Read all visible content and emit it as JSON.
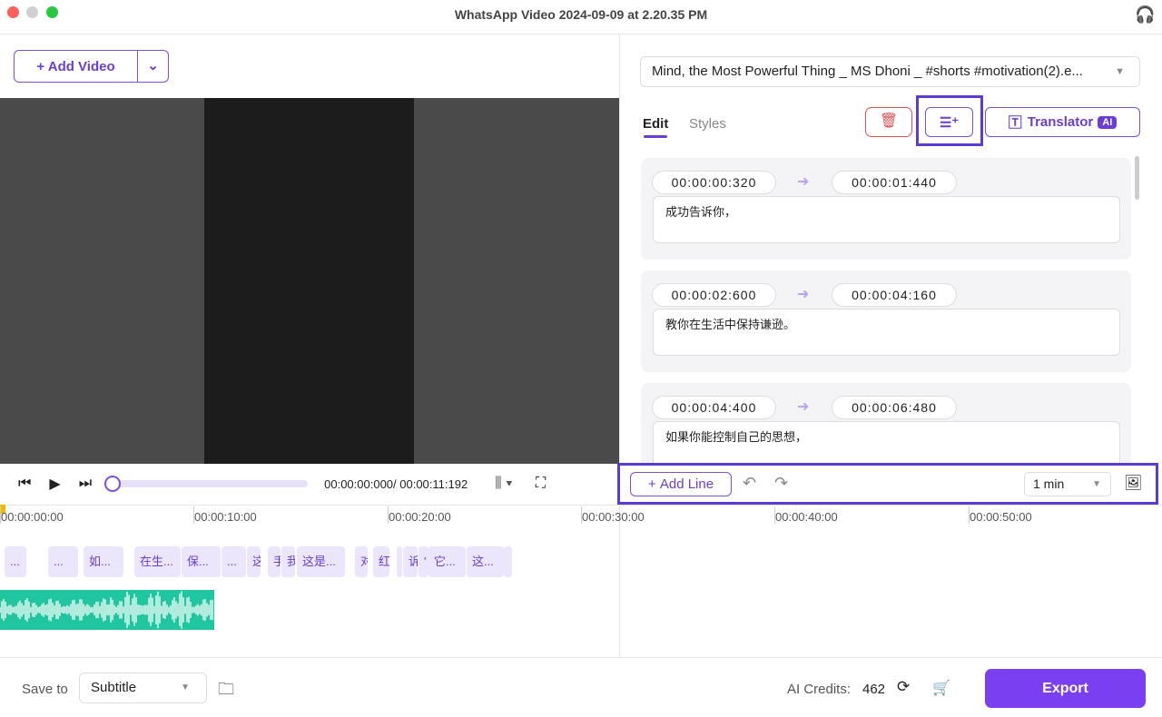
{
  "window": {
    "title": "WhatsApp Video 2024-09-09 at 2.20.35 PM"
  },
  "toolbar": {
    "add_video": "Add Video"
  },
  "player": {
    "time": "00:00:00:000/ 00:00:11:192",
    "progress": 0
  },
  "file_select": {
    "value": "Mind, the Most Powerful Thing _ MS Dhoni _ #shorts #motivation(2).e..."
  },
  "tabs": [
    {
      "label": "Edit",
      "active": true
    },
    {
      "label": "Styles",
      "active": false
    }
  ],
  "actions": {
    "translator": "Translator",
    "ai_badge": "AI"
  },
  "subtitles": [
    {
      "start": "00:00:00:320",
      "end": "00:00:01:440",
      "text": "成功告诉你，"
    },
    {
      "start": "00:00:02:600",
      "end": "00:00:04:160",
      "text": "教你在生活中保持谦逊。"
    },
    {
      "start": "00:00:04:400",
      "end": "00:00:06:480",
      "text": "如果你能控制自己的思想，"
    }
  ],
  "subtitle_toolbar": {
    "add_line": "Add Line",
    "duration": "1 min"
  },
  "timeline": {
    "ticks": [
      "00:00:00:00",
      "00:00:10:00",
      "00:00:20:00",
      "00:00:30:00",
      "00:00:40:00",
      "00:00:50:00"
    ],
    "clips": [
      "...",
      "...",
      "如...",
      "在生...",
      "保...",
      "...",
      "这",
      "手",
      "我",
      "这是...",
      "对",
      "红",
      "",
      "诉",
      "'",
      "它...",
      "这...",
      ""
    ]
  },
  "footer": {
    "save_to_label": "Save to",
    "save_to_value": "Subtitle",
    "credits_label": "AI Credits:",
    "credits_value": "462",
    "export": "Export"
  },
  "colors": {
    "accent": "#7b4ee0",
    "waveform": "#1fc6a0",
    "delete": "#e05050"
  }
}
